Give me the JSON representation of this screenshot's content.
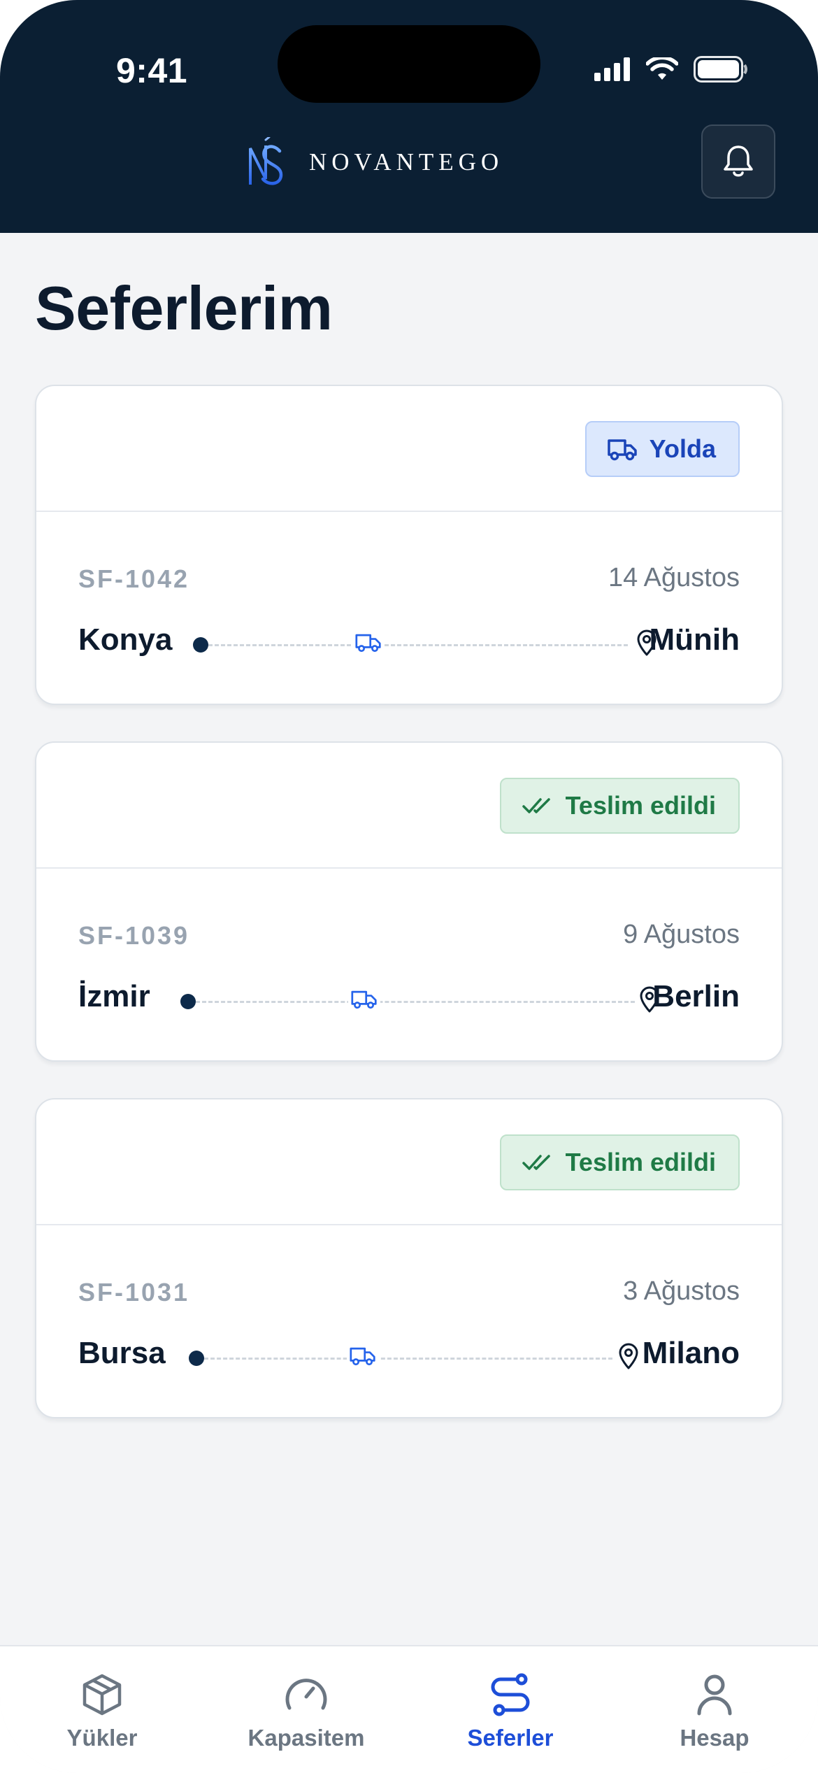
{
  "status_bar": {
    "time": "9:41"
  },
  "header": {
    "brand": "NOVANTEGO",
    "logo_mark": "NS"
  },
  "page": {
    "title": "Seferlerim"
  },
  "trips": [
    {
      "ref": "SF-1042",
      "date": "14 Ağustos",
      "from": "Konya",
      "to": "Münih",
      "status": "Yolda",
      "status_kind": "in-transit"
    },
    {
      "ref": "SF-1039",
      "date": "9 Ağustos",
      "from": "İzmir",
      "to": "Berlin",
      "status": "Teslim edildi",
      "status_kind": "delivered"
    },
    {
      "ref": "SF-1031",
      "date": "3 Ağustos",
      "from": "Bursa",
      "to": "Milano",
      "status": "Teslim edildi",
      "status_kind": "delivered"
    }
  ],
  "tabbar": {
    "items": [
      {
        "label": "Yükler",
        "icon": "package-icon",
        "active": false
      },
      {
        "label": "Kapasitem",
        "icon": "gauge-icon",
        "active": false
      },
      {
        "label": "Seferler",
        "icon": "route-icon",
        "active": true
      },
      {
        "label": "Hesap",
        "icon": "user-icon",
        "active": false
      }
    ]
  },
  "colors": {
    "header_bg": "#0b1f33",
    "accent": "#1d4ed8",
    "transit_badge_bg": "#dce8fd",
    "delivered_badge_bg": "#e0f2e6",
    "delivered_text": "#1f7a46"
  }
}
